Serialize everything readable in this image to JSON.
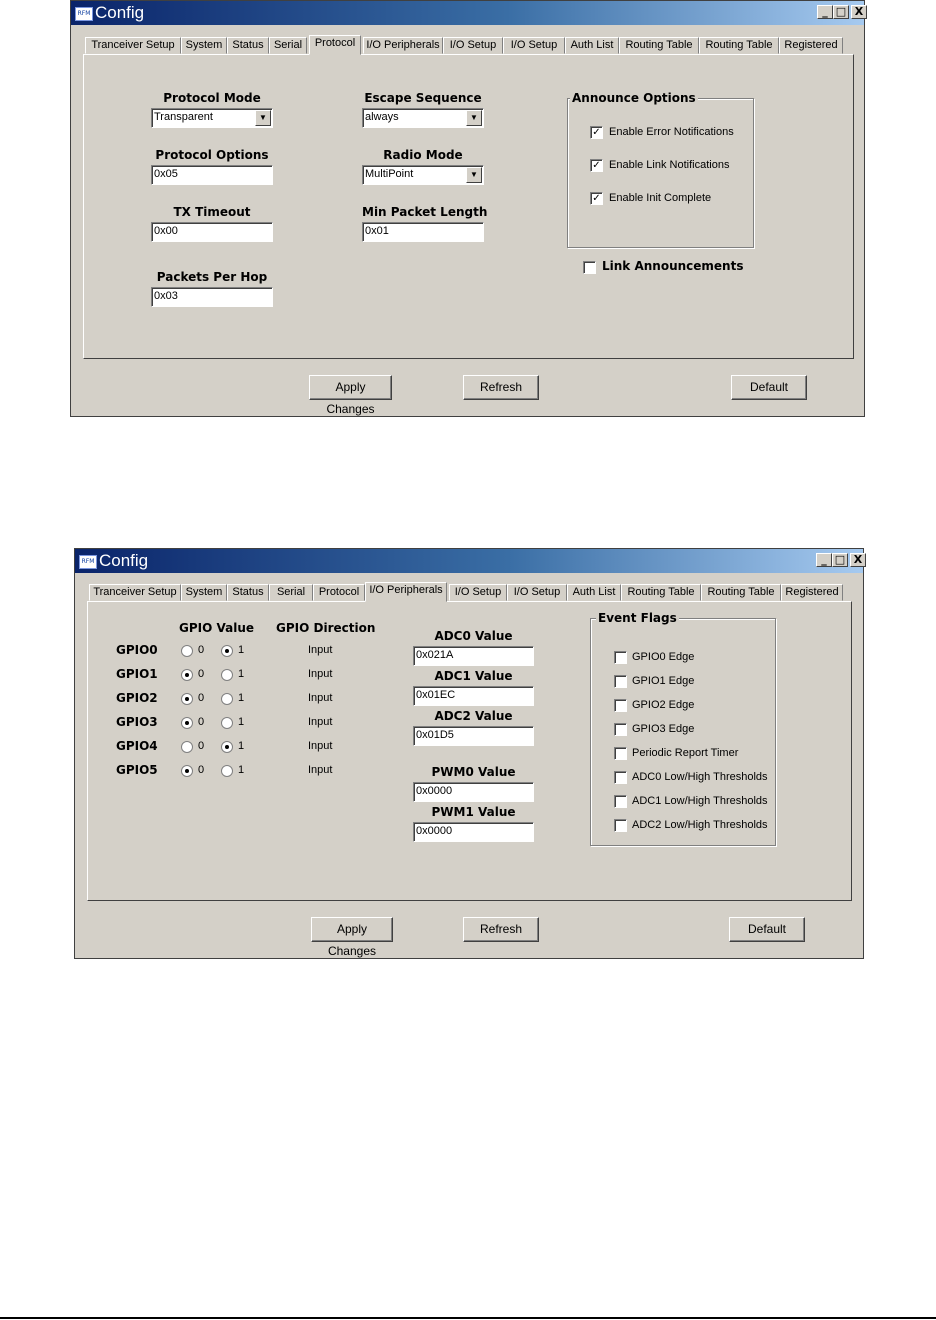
{
  "window1": {
    "icon_text": "RFM",
    "title": "Config",
    "controls": {
      "minimize": "_",
      "maximize": "□",
      "close": "X"
    },
    "tabs": [
      "Tranceiver Setup",
      "System",
      "Status",
      "Serial",
      "Protocol",
      "I/O Peripherals",
      "I/O Setup",
      "I/O Setup",
      "Auth List",
      "Routing Table",
      "Routing Table",
      "Registered"
    ],
    "active_tab": "Protocol",
    "protocol_mode": {
      "label": "Protocol Mode",
      "value": "Transparent"
    },
    "protocol_options": {
      "label": "Protocol Options",
      "value": "0x05"
    },
    "tx_timeout": {
      "label": "TX Timeout",
      "value": "0x00"
    },
    "packets_per_hop": {
      "label": "Packets Per Hop",
      "value": "0x03"
    },
    "escape_sequence": {
      "label": "Escape Sequence",
      "value": "always"
    },
    "radio_mode": {
      "label": "Radio Mode",
      "value": "MultiPoint"
    },
    "min_packet_length": {
      "label": "Min Packet Length",
      "value": "0x01"
    },
    "announce_options": {
      "title": "Announce Options",
      "items": [
        {
          "label": "Enable Error Notifications",
          "checked": true
        },
        {
          "label": "Enable Link Notifications",
          "checked": true
        },
        {
          "label": "Enable Init Complete",
          "checked": true
        }
      ]
    },
    "link_announcements": {
      "label": "Link Announcements",
      "checked": false
    },
    "buttons": {
      "apply": "Apply Changes",
      "refresh": "Refresh",
      "default": "Default"
    }
  },
  "window2": {
    "icon_text": "RFM",
    "title": "Config",
    "controls": {
      "minimize": "_",
      "maximize": "□",
      "close": "X"
    },
    "tabs": [
      "Tranceiver Setup",
      "System",
      "Status",
      "Serial",
      "Protocol",
      "I/O Peripherals",
      "I/O Setup",
      "I/O Setup",
      "Auth List",
      "Routing Table",
      "Routing Table",
      "Registered"
    ],
    "active_tab": "I/O Peripherals",
    "gpio_value_header": "GPIO Value",
    "gpio_direction_header": "GPIO Direction",
    "radio_zero": "0",
    "radio_one": "1",
    "gpios": [
      {
        "name": "GPIO0",
        "value": 1,
        "direction": "Input"
      },
      {
        "name": "GPIO1",
        "value": 0,
        "direction": "Input"
      },
      {
        "name": "GPIO2",
        "value": 0,
        "direction": "Input"
      },
      {
        "name": "GPIO3",
        "value": 0,
        "direction": "Input"
      },
      {
        "name": "GPIO4",
        "value": 1,
        "direction": "Input"
      },
      {
        "name": "GPIO5",
        "value": 0,
        "direction": "Input"
      }
    ],
    "adc0": {
      "label": "ADC0 Value",
      "value": "0x021A"
    },
    "adc1": {
      "label": "ADC1 Value",
      "value": "0x01EC"
    },
    "adc2": {
      "label": "ADC2 Value",
      "value": "0x01D5"
    },
    "pwm0": {
      "label": "PWM0 Value",
      "value": "0x0000"
    },
    "pwm1": {
      "label": "PWM1 Value",
      "value": "0x0000"
    },
    "event_flags": {
      "title": "Event Flags",
      "items": [
        {
          "label": "GPIO0 Edge",
          "checked": false
        },
        {
          "label": "GPIO1 Edge",
          "checked": false
        },
        {
          "label": "GPIO2 Edge",
          "checked": false
        },
        {
          "label": "GPIO3 Edge",
          "checked": false
        },
        {
          "label": "Periodic Report Timer",
          "checked": false
        },
        {
          "label": "ADC0 Low/High Thresholds",
          "checked": false
        },
        {
          "label": "ADC1 Low/High Thresholds",
          "checked": false
        },
        {
          "label": "ADC2 Low/High Thresholds",
          "checked": false
        }
      ]
    },
    "buttons": {
      "apply": "Apply Changes",
      "refresh": "Refresh",
      "default": "Default"
    }
  }
}
